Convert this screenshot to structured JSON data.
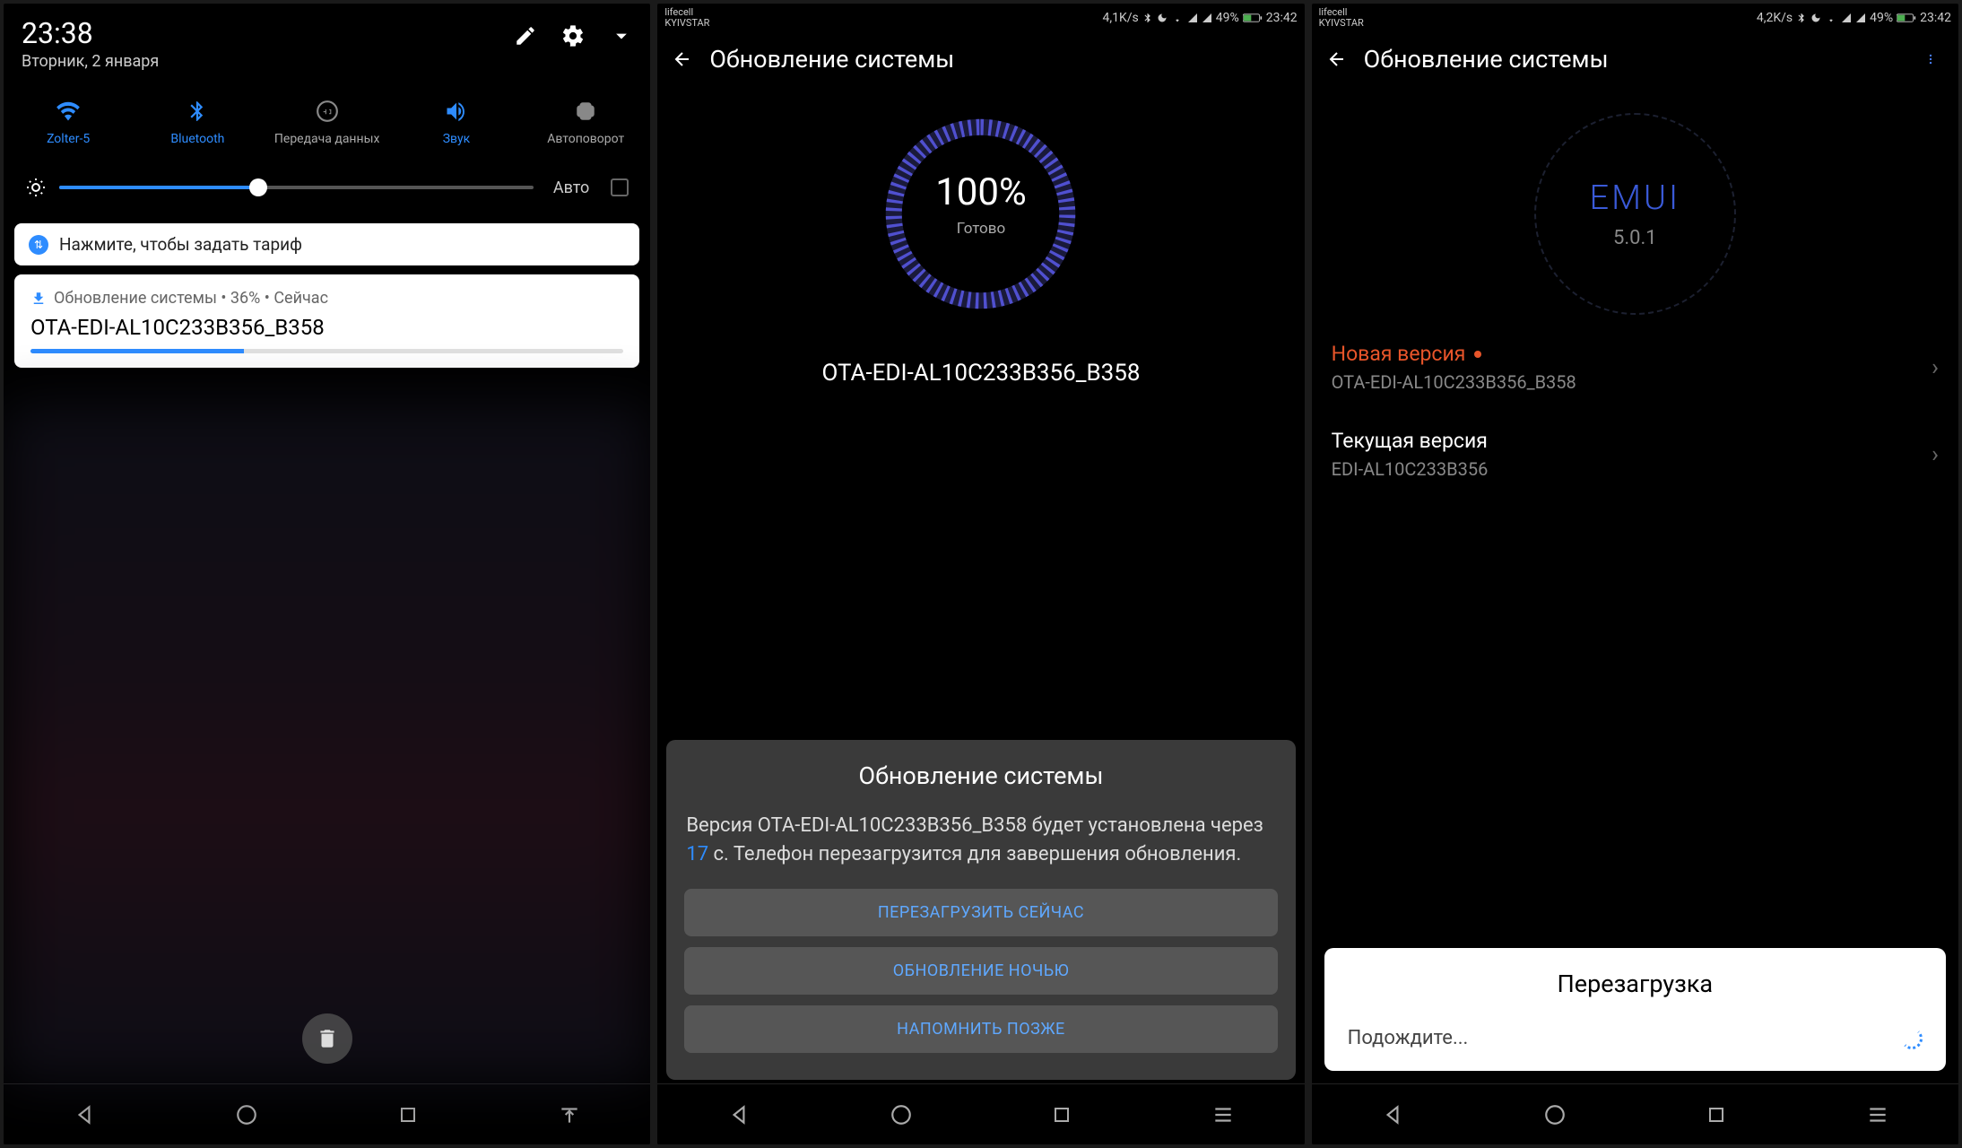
{
  "phone1": {
    "time": "23:38",
    "date": "Вторник, 2 января",
    "qs": [
      {
        "label": "Zolter-5",
        "name": "wifi"
      },
      {
        "label": "Bluetooth",
        "name": "bluetooth"
      },
      {
        "label": "Передача данных",
        "name": "data"
      },
      {
        "label": "Звук",
        "name": "sound"
      },
      {
        "label": "Автоповорот",
        "name": "autorotate"
      }
    ],
    "brightness_auto": "Авто",
    "notif1": "Нажмите, чтобы задать тариф",
    "notif2_head": "Обновление системы • 36% • Сейчас",
    "notif2_title": "OTA-EDI-AL10C233B356_B358"
  },
  "phone2": {
    "carrier_top": "lifecell",
    "carrier_bottom": "KYIVSTAR",
    "speed": "4,1K/s",
    "battery": "49%",
    "time": "23:42",
    "title": "Обновление системы",
    "percent": "100%",
    "ready": "Готово",
    "version": "OTA-EDI-AL10C233B356_B358",
    "dialog_title": "Обновление системы",
    "dialog_text1": "Версия OTA-EDI-AL10C233B356_B358 будет установлена через ",
    "dialog_countdown": "17",
    "dialog_text2": " с. Телефон перезагрузится для завершения обновления.",
    "btn1": "ПЕРЕЗАГРУЗИТЬ СЕЙЧАС",
    "btn2": "ОБНОВЛЕНИЕ НОЧЬЮ",
    "btn3": "НАПОМНИТЬ ПОЗЖЕ"
  },
  "phone3": {
    "carrier_top": "lifecell",
    "carrier_bottom": "KYIVSTAR",
    "speed": "4,2K/s",
    "battery": "49%",
    "time": "23:42",
    "title": "Обновление системы",
    "emui": "EMUI",
    "emui_version": "5.0.1",
    "new_version_label": "Новая версия",
    "new_version_value": "OTA-EDI-AL10C233B356_B358",
    "current_version_label": "Текущая версия",
    "current_version_value": "EDI-AL10C233B356",
    "toast_title": "Перезагрузка",
    "toast_text": "Подождите..."
  }
}
